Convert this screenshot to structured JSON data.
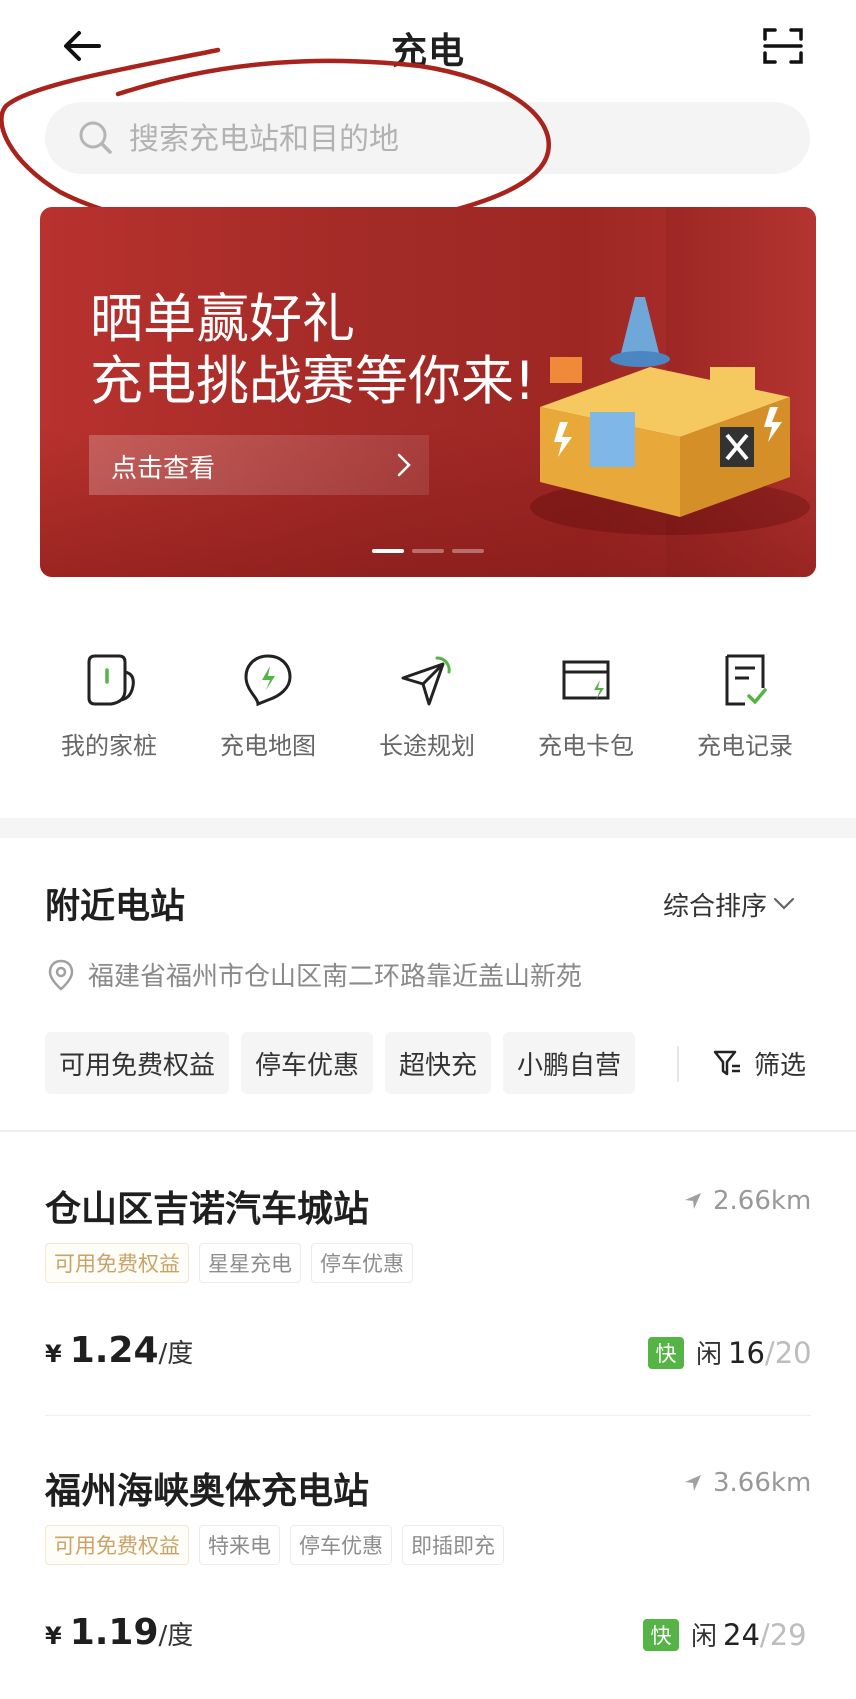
{
  "header": {
    "title": "充电",
    "back_icon": "back-arrow-icon",
    "scan_icon": "scan-icon"
  },
  "search": {
    "placeholder": "搜索充电站和目的地",
    "icon": "search-icon"
  },
  "banner": {
    "line1": "晒单赢好礼",
    "line2": "充电挑战赛等你来!",
    "button_label": "点击查看",
    "active_slide": 1,
    "slide_count": 3
  },
  "shortcuts": [
    {
      "label": "我的家桩",
      "icon": "home-charger-icon"
    },
    {
      "label": "充电地图",
      "icon": "charging-map-icon"
    },
    {
      "label": "长途规划",
      "icon": "route-plan-icon"
    },
    {
      "label": "充电卡包",
      "icon": "card-wallet-icon"
    },
    {
      "label": "充电记录",
      "icon": "charge-record-icon"
    }
  ],
  "nearby": {
    "title": "附近电站",
    "sort_label": "综合排序",
    "location": "福建省福州市仓山区南二环路靠近盖山新苑",
    "chips": [
      "可用免费权益",
      "停车优惠",
      "超快充",
      "小鹏自营"
    ],
    "filter_label": "筛选"
  },
  "stations": [
    {
      "name": "仓山区吉诺汽车城站",
      "distance": "2.66km",
      "tags": [
        "可用免费权益",
        "星星充电",
        "停车优惠"
      ],
      "currency": "¥",
      "price": "1.24",
      "unit": "/度",
      "fast_label": "快",
      "idle_label": "闲",
      "available": "16",
      "sep": "/",
      "total": "20"
    },
    {
      "name": "福州海峡奥体充电站",
      "distance": "3.66km",
      "tags": [
        "可用免费权益",
        "特来电",
        "停车优惠",
        "即插即充"
      ],
      "currency": "¥",
      "price": "1.19",
      "unit": "/度",
      "fast_label": "快",
      "idle_label": "闲",
      "available": "24",
      "sep": "/",
      "total": "29"
    }
  ],
  "colors": {
    "accent_green": "#55b445",
    "banner_red": "#a52a27",
    "annotation_red": "#a8231c",
    "gold_tag": "#c9a46a"
  }
}
